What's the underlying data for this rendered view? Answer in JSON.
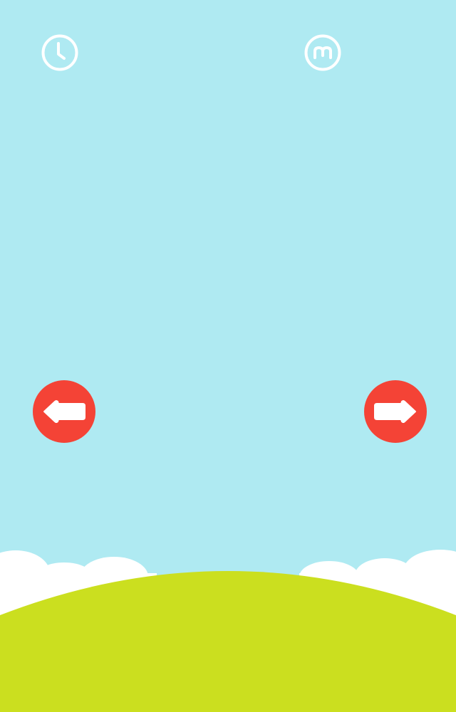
{
  "scene": {
    "sky_color": "#afeaf2",
    "cloud_color": "#ffffff",
    "hill_color": "#cbdf1f",
    "button_color": "#f44336",
    "icon_color": "#ffffff"
  },
  "hud": {
    "left_icon": "clock-icon",
    "right_icon": "smile-icon"
  },
  "controls": {
    "left_icon": "arrow-left-icon",
    "right_icon": "arrow-right-icon"
  }
}
